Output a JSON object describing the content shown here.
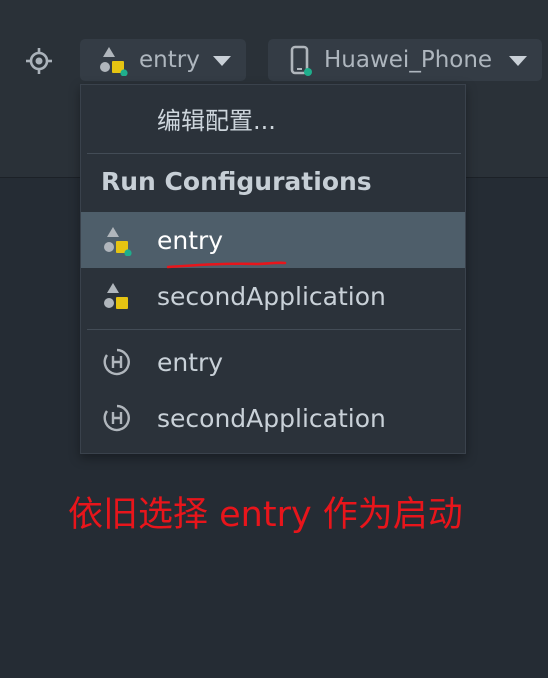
{
  "toolbar": {
    "run_config": {
      "label": "entry",
      "icon": "ohos-app-module-icon"
    },
    "device": {
      "label": "Huawei_Phone",
      "icon": "phone-device-icon"
    }
  },
  "dropdown": {
    "edit_label": "编辑配置...",
    "section_title": "Run Configurations",
    "items": [
      {
        "label": "entry",
        "icon": "ohos-app-module-icon",
        "selected": true
      },
      {
        "label": "secondApplication",
        "icon": "ohos-app-icon",
        "selected": false
      },
      {
        "label": "entry",
        "icon": "harmony-h-icon",
        "selected": false
      },
      {
        "label": "secondApplication",
        "icon": "harmony-h-icon",
        "selected": false
      }
    ]
  },
  "annotation": {
    "text": "依旧选择 entry 作为启动",
    "color": "#e8151b"
  },
  "colors": {
    "background": "#252c34",
    "selected_row": "#4e5e6a",
    "device_dot": "#1fae8c",
    "module_square": "#e6c412"
  }
}
